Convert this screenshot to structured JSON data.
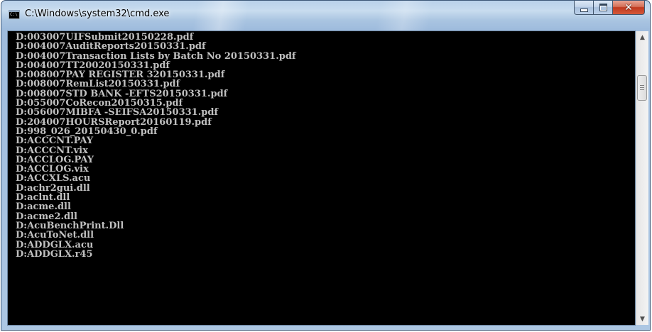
{
  "window": {
    "title": "C:\\Windows\\system32\\cmd.exe",
    "icon_text": "C:\\"
  },
  "caption": {
    "minimize": "",
    "maximize": "",
    "close": "✕"
  },
  "console": {
    "lines": [
      "D:003007UIFSubmit20150228.pdf",
      "D:004007AuditReports20150331.pdf",
      "D:004007Transaction Lists by Batch No 20150331.pdf",
      "D:004007TT20020150331.pdf",
      "D:008007PAY REGISTER 320150331.pdf",
      "D:008007RemList20150331.pdf",
      "D:008007STD BANK -EFTS20150331.pdf",
      "D:055007CoRecon20150315.pdf",
      "D:056007MIBFA -SEIFSA20150331.pdf",
      "D:204007HOURSReport20160119.pdf",
      "D:998_026_20150430_0.pdf",
      "D:ACCCNT.PAY",
      "D:ACCCNT.vix",
      "D:ACCLOG.PAY",
      "D:ACCLOG.vix",
      "D:ACCXLS.acu",
      "D:achr2gui.dll",
      "D:aclnt.dll",
      "D:acme.dll",
      "D:acme2.dll",
      "D:AcuBenchPrint.Dll",
      "D:AcuToNet.dll",
      "D:ADDGLX.acu",
      "D:ADDGLX.r45"
    ]
  },
  "scrollbar": {
    "up_arrow": "▲",
    "down_arrow": "▼"
  },
  "colors": {
    "console_bg": "#000000",
    "console_text": "#c0c0c0",
    "close_button": "#c7422a"
  }
}
